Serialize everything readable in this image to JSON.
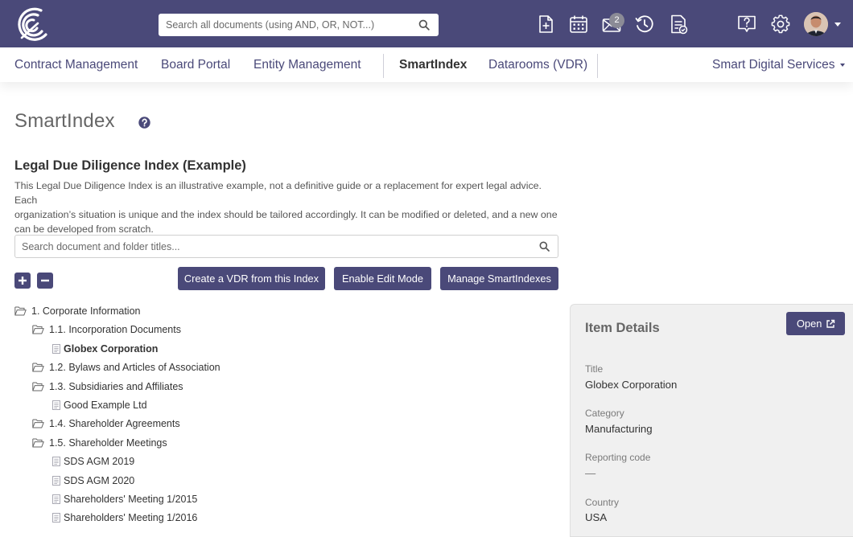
{
  "header": {
    "search_placeholder": "Search all documents (using AND, OR, NOT...)",
    "notification_count": "2",
    "icons": [
      "new-document-icon",
      "calendar-icon",
      "mail-icon",
      "history-icon",
      "tasks-icon",
      "help-icon",
      "settings-icon"
    ]
  },
  "nav": {
    "items": [
      {
        "label": "Contract Management"
      },
      {
        "label": "Board Portal"
      },
      {
        "label": "Entity Management"
      },
      {
        "label": "SmartIndex",
        "active": true
      },
      {
        "label": "Datarooms (VDR)"
      }
    ],
    "right_label": "Smart Digital Services"
  },
  "page": {
    "title": "SmartIndex",
    "index_title": "Legal Due Diligence Index (Example)",
    "index_description_lines": [
      "This Legal Due Diligence Index is an illustrative example, not a definitive guide or a replacement for expert legal advice. Each",
      "organization’s situation is unique and the index should be tailored accordingly. It can be modified or deleted, and a new one",
      "can be developed from scratch."
    ],
    "search_placeholder": "Search document and folder titles...",
    "buttons": {
      "create_vdr": "Create a VDR from this Index",
      "edit_mode": "Enable Edit Mode",
      "manage": "Manage SmartIndexes"
    }
  },
  "tree": [
    {
      "type": "folder",
      "level": 0,
      "label": "1. Corporate Information"
    },
    {
      "type": "folder",
      "level": 1,
      "label": "1.1. Incorporation Documents"
    },
    {
      "type": "doc",
      "level": 2,
      "label": "Globex Corporation",
      "selected": true
    },
    {
      "type": "folder",
      "level": 1,
      "label": "1.2. Bylaws and Articles of Association"
    },
    {
      "type": "folder",
      "level": 1,
      "label": "1.3. Subsidiaries and Affiliates"
    },
    {
      "type": "doc",
      "level": 2,
      "label": "Good Example Ltd"
    },
    {
      "type": "folder",
      "level": 1,
      "label": "1.4. Shareholder Agreements"
    },
    {
      "type": "folder",
      "level": 1,
      "label": "1.5. Shareholder Meetings"
    },
    {
      "type": "doc",
      "level": 2,
      "label": "SDS AGM 2019"
    },
    {
      "type": "doc",
      "level": 2,
      "label": "SDS AGM 2020"
    },
    {
      "type": "doc",
      "level": 2,
      "label": "Shareholders' Meeting 1/2015"
    },
    {
      "type": "doc",
      "level": 2,
      "label": "Shareholders' Meeting 1/2016"
    }
  ],
  "details": {
    "title": "Item Details",
    "open_label": "Open",
    "fields": [
      {
        "label": "Title",
        "value": "Globex Corporation"
      },
      {
        "label": "Category",
        "value": "Manufacturing"
      },
      {
        "label": "Reporting code",
        "value": "—"
      },
      {
        "label": "Country",
        "value": "USA"
      }
    ]
  },
  "colors": {
    "brand": "#4a4979",
    "panel": "#f0f0f0",
    "badge": "#8b8b96"
  }
}
